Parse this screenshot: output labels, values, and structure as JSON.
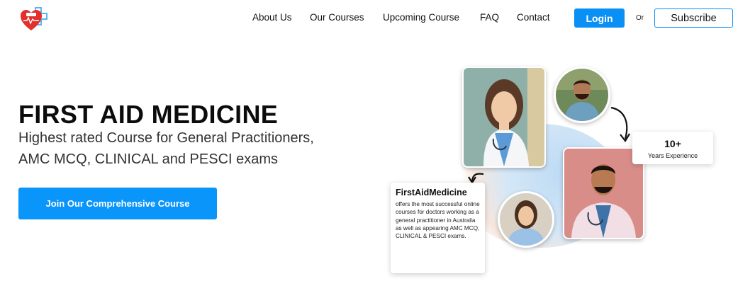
{
  "header": {
    "logo_icon": "heart-medical-cross-icon",
    "nav": [
      "About Us",
      "Our Courses",
      "Upcoming Course",
      "FAQ",
      "Contact"
    ],
    "login_label": "Login",
    "or_label": "Or",
    "subscribe_label": "Subscribe"
  },
  "hero": {
    "title": "FIRST AID MEDICINE",
    "subtitle_line1": "Highest rated Course for General Practitioners,",
    "subtitle_line2": "AMC MCQ, CLINICAL and PESCI exams",
    "cta_label": "Join Our Comprehensive Course"
  },
  "stats": {
    "value": "10+",
    "label": "Years Experience"
  },
  "info_card": {
    "title": "FirstAidMedicine",
    "body": "offers the most successful online courses for doctors working as a general practitioner in Australia as well as appearing AMC MCQ, CLINICAL & PESCI exams."
  },
  "colors": {
    "accent": "#0a90f5",
    "cta": "#0a95fb",
    "logo_heart": "#e2302c",
    "logo_cross": "#5bb4f0"
  }
}
